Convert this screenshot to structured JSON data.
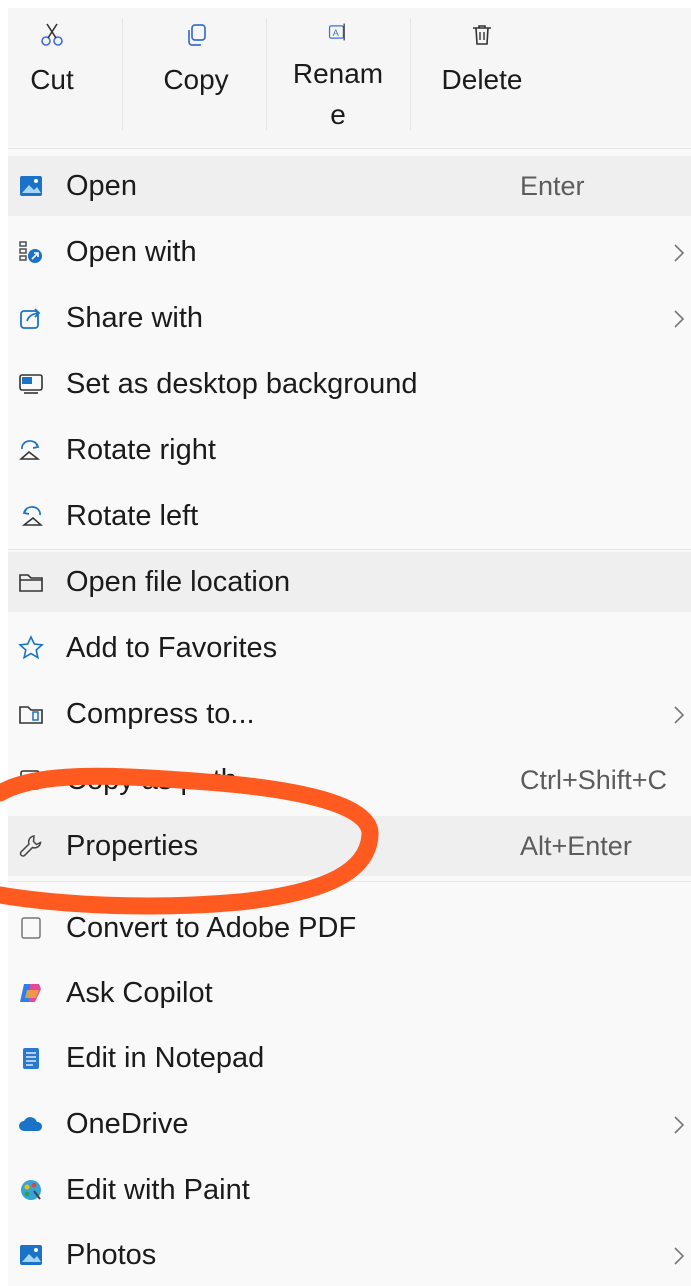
{
  "toolbar": {
    "cut": "Cut",
    "copy": "Copy",
    "rename_line1": "Renam",
    "rename_line2": "e",
    "delete": "Delete"
  },
  "items": [
    {
      "label": "Open",
      "shortcut": "Enter",
      "icon": "photo-app-icon"
    },
    {
      "label": "Open with",
      "icon": "open-with-icon",
      "submenu": true
    },
    {
      "label": "Share with",
      "icon": "share-icon",
      "submenu": true
    },
    {
      "label": "Set as desktop background",
      "icon": "desktop-background-icon"
    },
    {
      "label": "Rotate right",
      "icon": "rotate-right-icon"
    },
    {
      "label": "Rotate left",
      "icon": "rotate-left-icon"
    },
    {
      "label": "Open file location",
      "icon": "folder-icon"
    },
    {
      "label": "Add to Favorites",
      "icon": "star-icon"
    },
    {
      "label": "Compress to...",
      "icon": "zip-folder-icon",
      "submenu": true
    },
    {
      "label": "Copy as path",
      "shortcut": "Ctrl+Shift+C",
      "icon": "copy-path-icon"
    },
    {
      "label": "Properties",
      "shortcut": "Alt+Enter",
      "icon": "wrench-icon"
    },
    {
      "label": "Convert to Adobe PDF",
      "icon": "pdf-icon"
    },
    {
      "label": "Ask Copilot",
      "icon": "copilot-icon"
    },
    {
      "label": "Edit in Notepad",
      "icon": "notepad-icon"
    },
    {
      "label": "OneDrive",
      "icon": "cloud-icon",
      "submenu": true
    },
    {
      "label": "Edit with Paint",
      "icon": "paint-icon"
    },
    {
      "label": "Photos",
      "icon": "photos-icon",
      "submenu": true
    }
  ],
  "colors": {
    "accent": "#1a73c7",
    "highlight": "#efefef",
    "annotation": "#ff5a1f"
  }
}
